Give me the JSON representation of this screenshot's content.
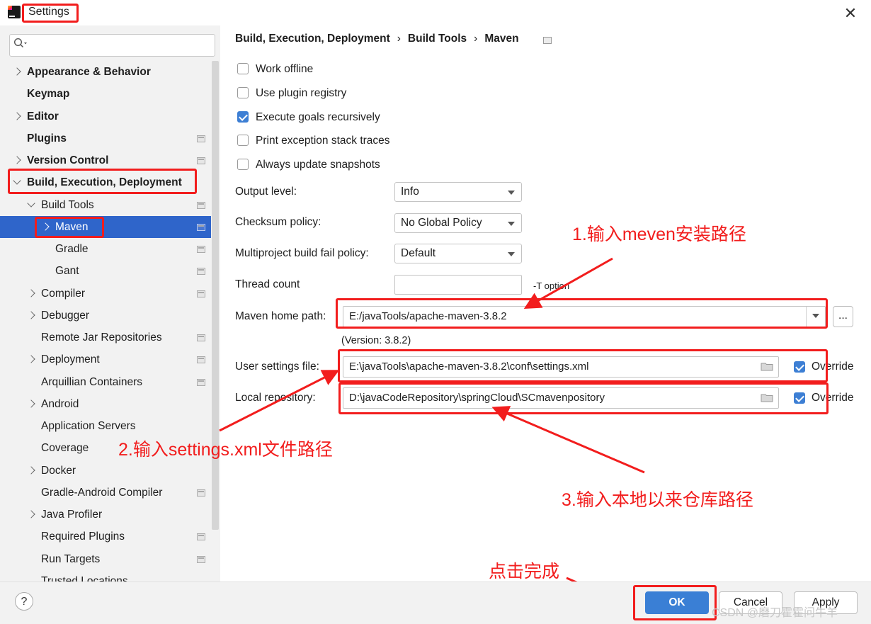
{
  "window": {
    "title": "Settings",
    "close_glyph": "✕"
  },
  "search": {
    "placeholder": ""
  },
  "sidebar": {
    "items": [
      {
        "label": "Appearance & Behavior",
        "bold": true,
        "chevron": "right"
      },
      {
        "label": "Keymap",
        "bold": true
      },
      {
        "label": "Editor",
        "bold": true,
        "chevron": "right"
      },
      {
        "label": "Plugins",
        "bold": true,
        "project_icon": true
      },
      {
        "label": "Version Control",
        "bold": true,
        "chevron": "right",
        "project_icon": true
      },
      {
        "label": "Build, Execution, Deployment",
        "bold": true,
        "chevron": "down"
      },
      {
        "label": "Build Tools",
        "chevron": "down",
        "project_icon": true
      },
      {
        "label": "Maven",
        "chevron": "right",
        "project_icon": true,
        "selected": true
      },
      {
        "label": "Gradle",
        "project_icon": true
      },
      {
        "label": "Gant",
        "project_icon": true
      },
      {
        "label": "Compiler",
        "chevron": "right",
        "project_icon": true
      },
      {
        "label": "Debugger",
        "chevron": "right"
      },
      {
        "label": "Remote Jar Repositories",
        "project_icon": true
      },
      {
        "label": "Deployment",
        "chevron": "right",
        "project_icon": true
      },
      {
        "label": "Arquillian Containers",
        "project_icon": true
      },
      {
        "label": "Android",
        "chevron": "right"
      },
      {
        "label": "Application Servers"
      },
      {
        "label": "Coverage"
      },
      {
        "label": "Docker",
        "chevron": "right"
      },
      {
        "label": "Gradle-Android Compiler",
        "project_icon": true
      },
      {
        "label": "Java Profiler",
        "chevron": "right"
      },
      {
        "label": "Required Plugins",
        "project_icon": true
      },
      {
        "label": "Run Targets",
        "project_icon": true
      },
      {
        "label": "Trusted Locations"
      }
    ]
  },
  "breadcrumb": {
    "items": [
      "Build, Execution, Deployment",
      "Build Tools",
      "Maven"
    ],
    "separator": "›"
  },
  "checkboxes": [
    {
      "label": "Work offline",
      "checked": false
    },
    {
      "label": "Use plugin registry",
      "checked": false
    },
    {
      "label": "Execute goals recursively",
      "checked": true
    },
    {
      "label": "Print exception stack traces",
      "checked": false
    },
    {
      "label": "Always update snapshots",
      "checked": false
    }
  ],
  "form": {
    "output_level": {
      "label": "Output level:",
      "value": "Info"
    },
    "checksum_policy": {
      "label": "Checksum policy:",
      "value": "No Global Policy"
    },
    "fail_policy": {
      "label": "Multiproject build fail policy:",
      "value": "Default"
    },
    "thread_count": {
      "label": "Thread count",
      "value": "",
      "hint": "-T option"
    },
    "maven_home": {
      "label": "Maven home path:",
      "value": "E:/javaTools/apache-maven-3.8.2",
      "browse": "...",
      "version": "(Version: 3.8.2)"
    },
    "user_settings": {
      "label": "User settings file:",
      "value": "E:\\javaTools\\apache-maven-3.8.2\\conf\\settings.xml",
      "override_label": "Override",
      "override_checked": true
    },
    "local_repo": {
      "label": "Local repository:",
      "value": "D:\\javaCodeRepository\\springCloud\\SCmavenpository",
      "override_label": "Override",
      "override_checked": true
    }
  },
  "annotations": {
    "step1": "1.输入meven安装路径",
    "step2": "2.输入settings.xml文件路径",
    "step3": "3.输入本地以来仓库路径",
    "finish": "点击完成",
    "color": "#f21d1d"
  },
  "buttons": {
    "help": "?",
    "ok": "OK",
    "cancel": "Cancel",
    "apply": "Apply"
  },
  "watermark": "CSDN @磨刀霍霍问牛羊",
  "colors": {
    "selection": "#2f65ca",
    "accent": "#3a7fd5",
    "sidebar_bg": "#f2f2f2"
  }
}
